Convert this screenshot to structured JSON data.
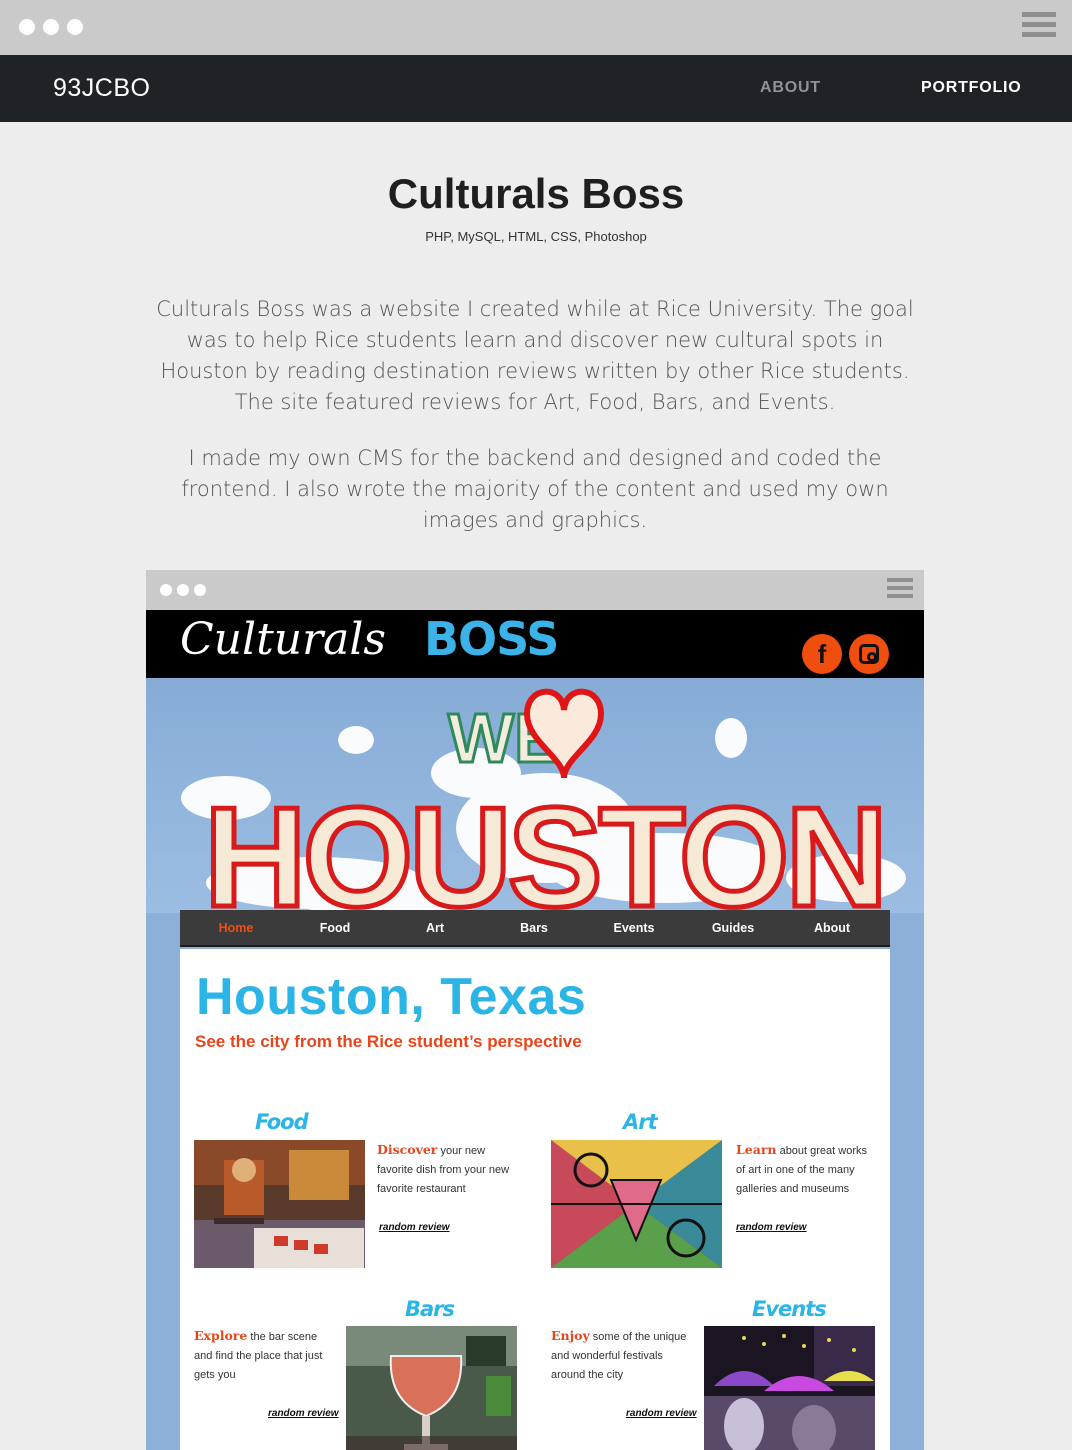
{
  "site": {
    "brand": "93JCBO",
    "nav": {
      "about": "ABOUT",
      "portfolio": "PORTFOLIO"
    }
  },
  "project": {
    "title": "Culturals Boss",
    "tech": "PHP, MySQL, HTML, CSS, Photoshop",
    "paragraph1": "Culturals Boss was a website I created while at Rice University. The goal was to help Rice students learn and discover new cultural spots in Houston by reading destination reviews written by other Rice students. The site featured reviews for Art, Food, Bars, and Events.",
    "paragraph2": "I made my own CMS for the backend and designed and coded the frontend. I also wrote the majority of the content and used my own images and graphics."
  },
  "screenshot": {
    "logo_part1": "Culturals",
    "logo_part2": "BOSS",
    "social": {
      "facebook": "f"
    },
    "hero": {
      "we": "WE",
      "city": "HOUSTON"
    },
    "nav": [
      "Home",
      "Food",
      "Art",
      "Bars",
      "Events",
      "Guides",
      "About"
    ],
    "heading": "Houston, Texas",
    "subheading": "See the city from the Rice student’s perspective",
    "sections": {
      "food": {
        "title": "Food",
        "lead": "Discover",
        "text": " your new favorite dish from your new favorite restaurant",
        "link": "random review"
      },
      "art": {
        "title": "Art",
        "lead": "Learn",
        "text": " about great works of art in one of the many galleries and museums",
        "link": "random review"
      },
      "bars": {
        "title": "Bars",
        "lead": "Explore",
        "text": " the bar scene and find the place that just gets you",
        "link": "random review"
      },
      "events": {
        "title": "Events",
        "lead": "Enjoy",
        "text": " some of the unique and wonderful festivals around the city",
        "link": "random review"
      }
    }
  },
  "colors": {
    "accent_blue": "#2bb4e6",
    "accent_orange": "#e8451a",
    "nav_dark": "#1f2326",
    "frame_blue": "#8db0d9"
  }
}
